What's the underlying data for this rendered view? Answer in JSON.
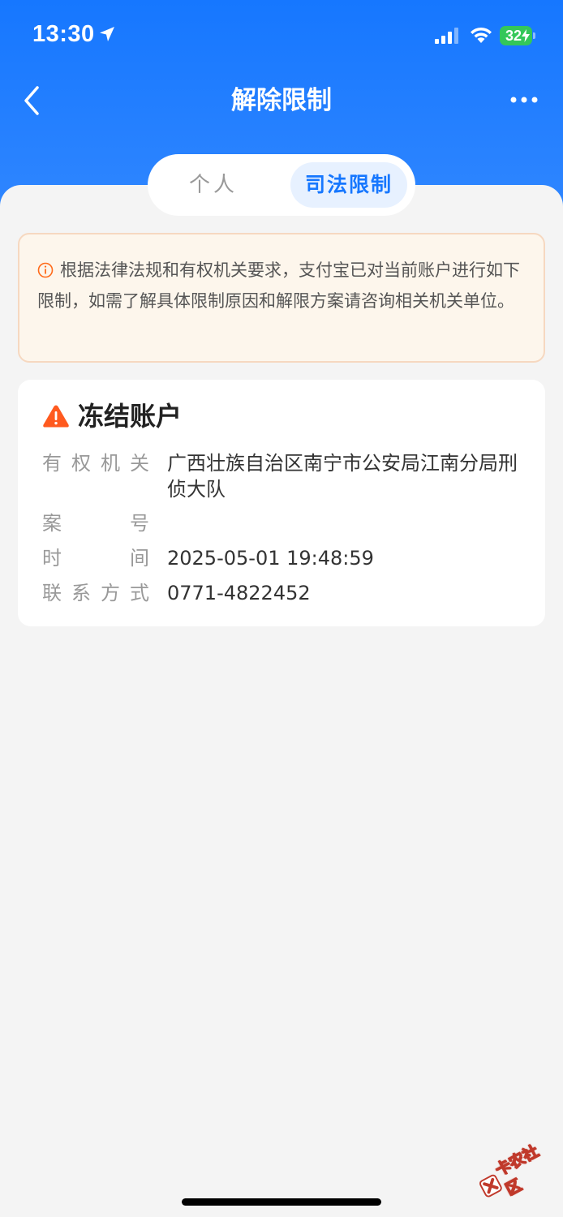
{
  "status_bar": {
    "time": "13:30",
    "battery": "32",
    "location_icon": "location-arrow-icon",
    "signal_icon": "cellular-signal-icon",
    "wifi_icon": "wifi-icon",
    "battery_icon": "battery-charging-icon"
  },
  "nav": {
    "title": "解除限制",
    "back_icon": "chevron-left-icon",
    "more_icon": "more-horizontal-icon"
  },
  "tabs": [
    {
      "label": "个人",
      "active": false
    },
    {
      "label": "司法限制",
      "active": true
    }
  ],
  "notice": {
    "icon": "info-circle-icon",
    "text": "根据法律法规和有权机关要求，支付宝已对当前账户进行如下限制，如需了解具体限制原因和解限方案请咨询相关机关单位。"
  },
  "restriction": {
    "icon": "warning-triangle-icon",
    "title": "冻结账户",
    "rows": [
      {
        "label": "有权机关",
        "value": "广西壮族自治区南宁市公安局江南分局刑侦大队"
      },
      {
        "label": "案号",
        "value": ""
      },
      {
        "label": "时间",
        "value": "2025-05-01 19:48:59"
      },
      {
        "label": "联系方式",
        "value": "0771-4822452"
      }
    ]
  },
  "watermark": {
    "text": "卡农社区"
  },
  "colors": {
    "brand_blue": "#1677ff",
    "warning_orange": "#ff5a1f",
    "notice_bg": "#fdf6ec"
  }
}
